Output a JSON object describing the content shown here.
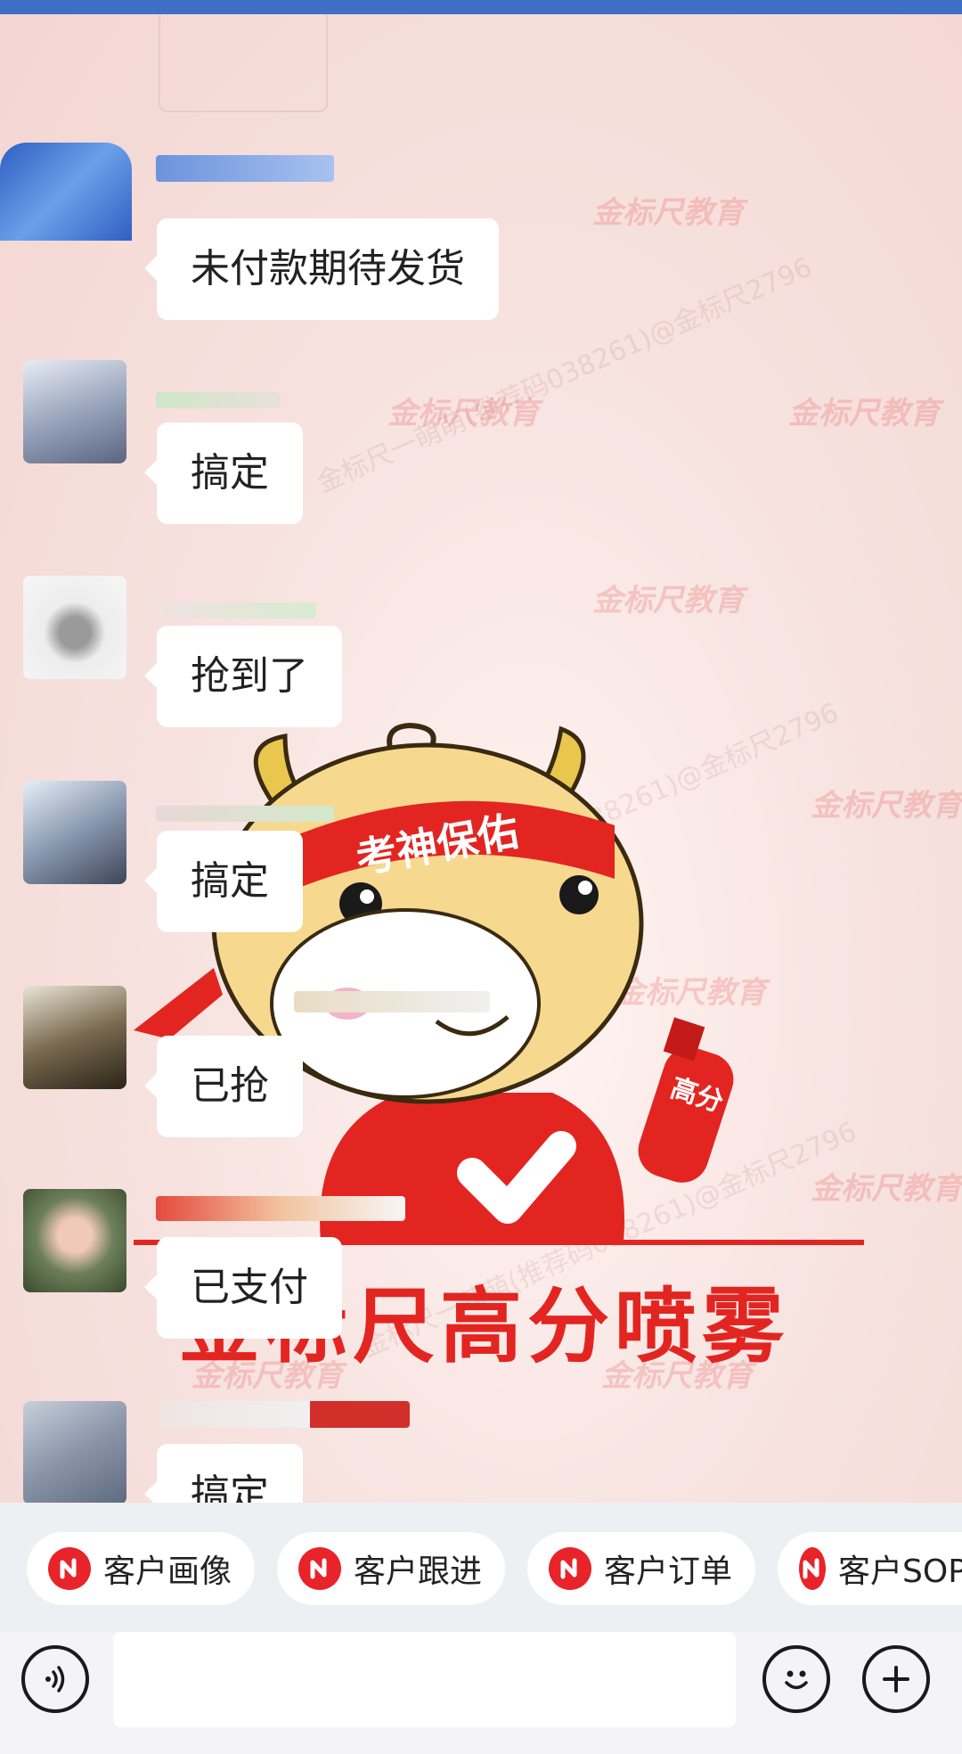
{
  "colors": {
    "top_bar": "#3f6fc4",
    "chat_background": "#f6dfdc",
    "bubble": "#ffffff",
    "brand_red": "#e8232a",
    "input_area": "#eeeff3"
  },
  "watermark": {
    "brand": "金标尺教育",
    "user": "金标尺一萌萌(推荐码038261)@金标尺2796"
  },
  "messages": [
    {
      "text": "未付款期待发货",
      "avatar": "blurred-avatar"
    },
    {
      "text": "搞定",
      "avatar": "blurred-avatar"
    },
    {
      "text": "抢到了",
      "avatar": "blurred-avatar"
    },
    {
      "text": "搞定",
      "avatar": "blurred-avatar"
    },
    {
      "text": "已抢",
      "avatar": "blurred-avatar"
    },
    {
      "text": "已支付",
      "avatar": "blurred-avatar"
    },
    {
      "text": "搞定",
      "avatar": "blurred-avatar"
    }
  ],
  "sticker": {
    "headband": "考神保佑",
    "bottle": "高分",
    "caption": "金标尺高分喷雾"
  },
  "quick_actions": [
    {
      "label": "客户画像",
      "icon": "brand-logo-icon"
    },
    {
      "label": "客户跟进",
      "icon": "brand-logo-icon"
    },
    {
      "label": "客户订单",
      "icon": "brand-logo-icon"
    },
    {
      "label": "客户SOP",
      "icon": "brand-logo-icon"
    }
  ],
  "input": {
    "placeholder": "",
    "voice_icon": "voice-icon",
    "emoji_icon": "emoji-icon",
    "more_icon": "plus-icon"
  }
}
